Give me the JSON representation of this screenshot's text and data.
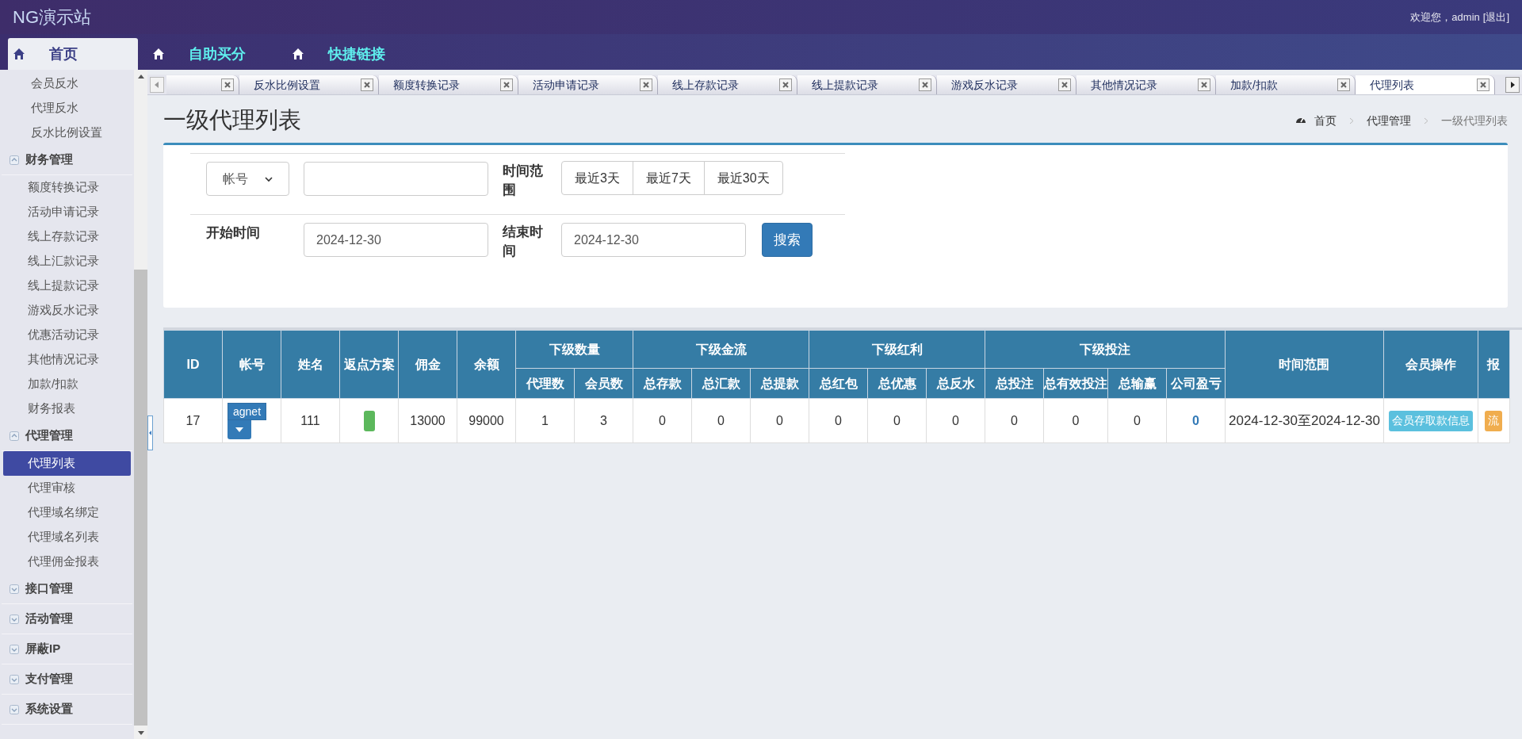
{
  "header": {
    "title": "NG演示站",
    "welcome": "欢迎您，admin",
    "logout": "[退出]"
  },
  "nav": [
    {
      "label": "首页",
      "selected": true
    },
    {
      "label": "自助买分",
      "selected": false
    },
    {
      "label": "快捷链接",
      "selected": false
    }
  ],
  "sidebar": {
    "items": [
      {
        "label": "会员反水",
        "selected": false
      },
      {
        "label": "代理反水",
        "selected": false
      },
      {
        "label": "反水比例设置",
        "selected": false
      }
    ],
    "groups": [
      {
        "title": "财务管理",
        "expanded": true,
        "items": [
          {
            "label": "额度转换记录",
            "selected": false
          },
          {
            "label": "活动申请记录",
            "selected": false
          },
          {
            "label": "线上存款记录",
            "selected": false
          },
          {
            "label": "线上汇款记录",
            "selected": false
          },
          {
            "label": "线上提款记录",
            "selected": false
          },
          {
            "label": "游戏反水记录",
            "selected": false
          },
          {
            "label": "优惠活动记录",
            "selected": false
          },
          {
            "label": "其他情况记录",
            "selected": false
          },
          {
            "label": "加款/扣款",
            "selected": false
          },
          {
            "label": "财务报表",
            "selected": false
          }
        ]
      },
      {
        "title": "代理管理",
        "expanded": true,
        "items": [
          {
            "label": "代理列表",
            "selected": true
          },
          {
            "label": "代理审核",
            "selected": false
          },
          {
            "label": "代理域名绑定",
            "selected": false
          },
          {
            "label": "代理域名列表",
            "selected": false
          },
          {
            "label": "代理佣金报表",
            "selected": false
          }
        ]
      },
      {
        "title": "接口管理",
        "expanded": false
      },
      {
        "title": "活动管理",
        "expanded": false
      },
      {
        "title": "屏蔽IP",
        "expanded": false
      },
      {
        "title": "支付管理",
        "expanded": false
      },
      {
        "title": "系统设置",
        "expanded": false
      }
    ]
  },
  "tabs": [
    {
      "selected": false
    },
    {
      "label": "反水比例设置",
      "selected": false
    },
    {
      "label": "额度转换记录",
      "selected": false
    },
    {
      "label": "活动申请记录",
      "selected": false
    },
    {
      "label": "线上存款记录",
      "selected": false
    },
    {
      "label": "线上提款记录",
      "selected": false
    },
    {
      "label": "游戏反水记录",
      "selected": false
    },
    {
      "label": "其他情况记录",
      "selected": false
    },
    {
      "label": "加款/扣款",
      "selected": false
    },
    {
      "label": "代理列表",
      "selected": true
    }
  ],
  "page": {
    "title": "一级代理列表",
    "breadcrumb": [
      "首页",
      "代理管理",
      "一级代理列表"
    ]
  },
  "filters": {
    "field_select": "帐号",
    "time_range_label": "时间范围",
    "quick_ranges": [
      "最近3天",
      "最近7天",
      "最近30天"
    ],
    "start_label": "开始时间",
    "start_value": "2024-12-30",
    "end_label": "结束时间",
    "end_value": "2024-12-30",
    "search": "搜索"
  },
  "table": {
    "columns": [
      {
        "label": "ID"
      },
      {
        "label": "帐号"
      },
      {
        "label": "姓名"
      },
      {
        "label": "返点方案"
      },
      {
        "label": "佣金"
      },
      {
        "label": "余额"
      },
      {
        "label": "下级数量",
        "children": [
          "代理数",
          "会员数"
        ]
      },
      {
        "label": "下级金流",
        "children": [
          "总存款",
          "总汇款",
          "总提款"
        ]
      },
      {
        "label": "下级红利",
        "children": [
          "总红包",
          "总优惠",
          "总反水"
        ]
      },
      {
        "label": "下级投注",
        "children": [
          "总投注",
          "总有效投注",
          "总输赢",
          "公司盈亏"
        ]
      },
      {
        "label": "时间范围"
      },
      {
        "label": "会员操作"
      },
      {
        "label": "报"
      }
    ],
    "rows": [
      {
        "id": "17",
        "account": "agnet",
        "name": "111",
        "commission": "13000",
        "balance": "99000",
        "stats": [
          "1",
          "3",
          "0",
          "0",
          "0",
          "0",
          "0",
          "0",
          "0",
          "0",
          "0"
        ],
        "profit": "0",
        "time_range": "2024-12-30至2024-12-30",
        "actions": [
          {
            "label": "会员存取款信息",
            "kind": "info"
          },
          {
            "label": "流",
            "kind": "warning"
          }
        ]
      }
    ]
  }
}
